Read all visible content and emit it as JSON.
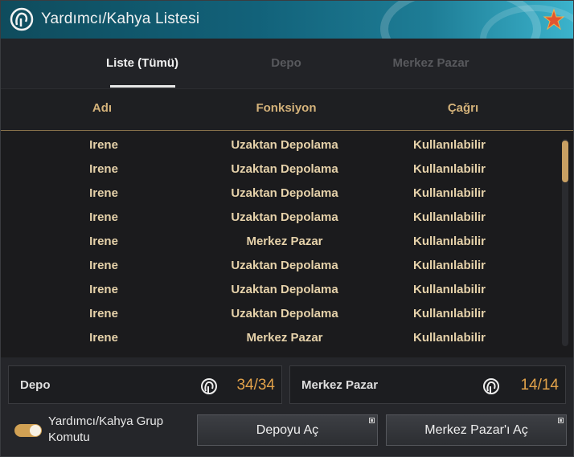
{
  "window": {
    "title": "Yardımcı/Kahya Listesi"
  },
  "tabs": [
    {
      "label": "Liste (Tümü)",
      "active": true
    },
    {
      "label": "Depo",
      "active": false
    },
    {
      "label": "Merkez Pazar",
      "active": false
    }
  ],
  "columns": [
    "Adı",
    "Fonksiyon",
    "Çağrı"
  ],
  "rows": [
    [
      "Irene",
      "Uzaktan Depolama",
      "Kullanılabilir"
    ],
    [
      "Irene",
      "Uzaktan Depolama",
      "Kullanılabilir"
    ],
    [
      "Irene",
      "Uzaktan Depolama",
      "Kullanılabilir"
    ],
    [
      "Irene",
      "Uzaktan Depolama",
      "Kullanılabilir"
    ],
    [
      "Irene",
      "Merkez Pazar",
      "Kullanılabilir"
    ],
    [
      "Irene",
      "Uzaktan Depolama",
      "Kullanılabilir"
    ],
    [
      "Irene",
      "Uzaktan Depolama",
      "Kullanılabilir"
    ],
    [
      "Irene",
      "Uzaktan Depolama",
      "Kullanılabilir"
    ],
    [
      "Irene",
      "Merkez Pazar",
      "Kullanılabilir"
    ]
  ],
  "summary": {
    "depo": {
      "label": "Depo",
      "count": "34/34",
      "icon": "helper-icon"
    },
    "pazar": {
      "label": "Merkez Pazar",
      "count": "14/14",
      "icon": "helper-icon"
    }
  },
  "group_command": {
    "label": "Yardımcı/Kahya Grup Komutu",
    "enabled": true
  },
  "buttons": {
    "open_depo": "Depoyu Aç",
    "open_pazar": "Merkez Pazar'ı Aç"
  },
  "colors": {
    "accent": "#d4b27a",
    "count": "#e2a24a",
    "title_bar": "#12627a"
  }
}
